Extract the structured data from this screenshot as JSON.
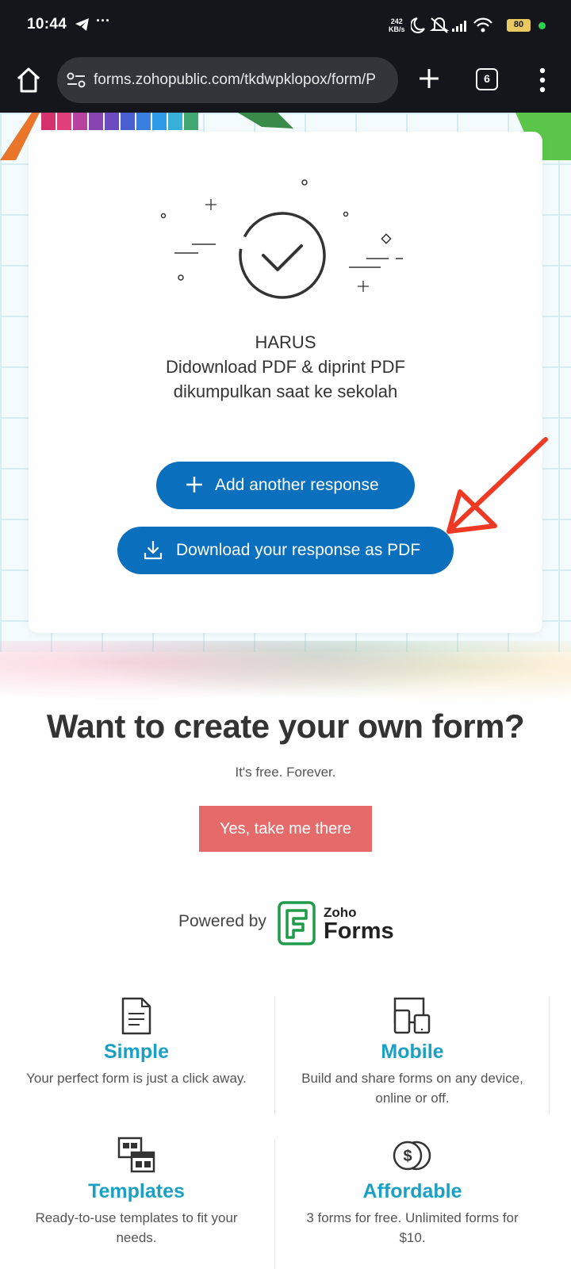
{
  "status_bar": {
    "time": "10:44",
    "overflow": "···",
    "speed_value": "242",
    "speed_unit": "KB/s",
    "battery": "80"
  },
  "browser": {
    "url": "forms.zohopublic.com/tkdwpklopox/form/P",
    "tab_count": "6"
  },
  "card": {
    "message_lines": [
      "HARUS",
      "Didownload PDF & diprint PDF",
      "dikumpulkan saat ke sekolah"
    ],
    "add_button": "Add another response",
    "download_button": "Download your response as PDF"
  },
  "promo": {
    "title": "Want to create your own form?",
    "subtitle": "It's free. Forever.",
    "cta": "Yes, take me there",
    "powered_by": "Powered by",
    "brand_small": "Zoho",
    "brand_large": "Forms"
  },
  "features": [
    {
      "icon": "document-icon",
      "title": "Simple",
      "desc": "Your perfect form is just a click away."
    },
    {
      "icon": "devices-icon",
      "title": "Mobile",
      "desc": "Build and share forms on any device, online or off."
    },
    {
      "icon": "templates-icon",
      "title": "Templates",
      "desc": "Ready-to-use templates to fit your needs."
    },
    {
      "icon": "dollar-coins-icon",
      "title": "Affordable",
      "desc": "3 forms for free. Unlimited forms for $10."
    }
  ],
  "colors": {
    "primary_button": "#0a6fbd",
    "cta_button": "#e56b6b",
    "feature_title": "#1aa0c4",
    "annotation_arrow": "#ee3a24"
  }
}
